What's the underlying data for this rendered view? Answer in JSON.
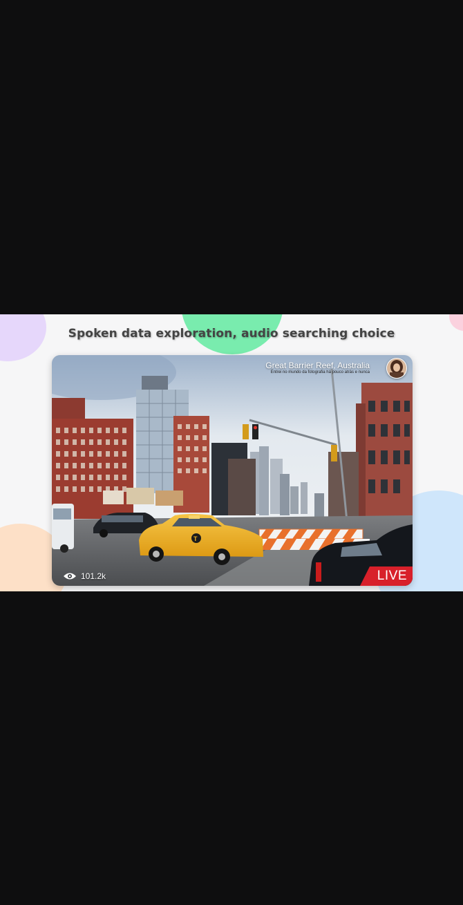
{
  "banner": {
    "headline": "Spoken data exploration, audio searching choice"
  },
  "stream": {
    "title": "Great Barrier Reef, Australia",
    "subtitle": "Entrei no mundo da fotografia há pouco atrás e nunca",
    "viewer_count": "101.2k",
    "live_label": "LIVE",
    "icons": {
      "viewers": "eye-icon",
      "avatar": "streamer-avatar"
    }
  },
  "colors": {
    "page_background": "#0e0e0f",
    "banner_background": "#f6f6f7",
    "live_red": "#d8202a",
    "taxi_yellow": "#f0b323",
    "accent_green": "#79ecae",
    "accent_purple": "#e6d7fb",
    "accent_blue": "#cfe6fb",
    "accent_peach": "#fde0c7",
    "accent_pink": "#fbd1de"
  }
}
